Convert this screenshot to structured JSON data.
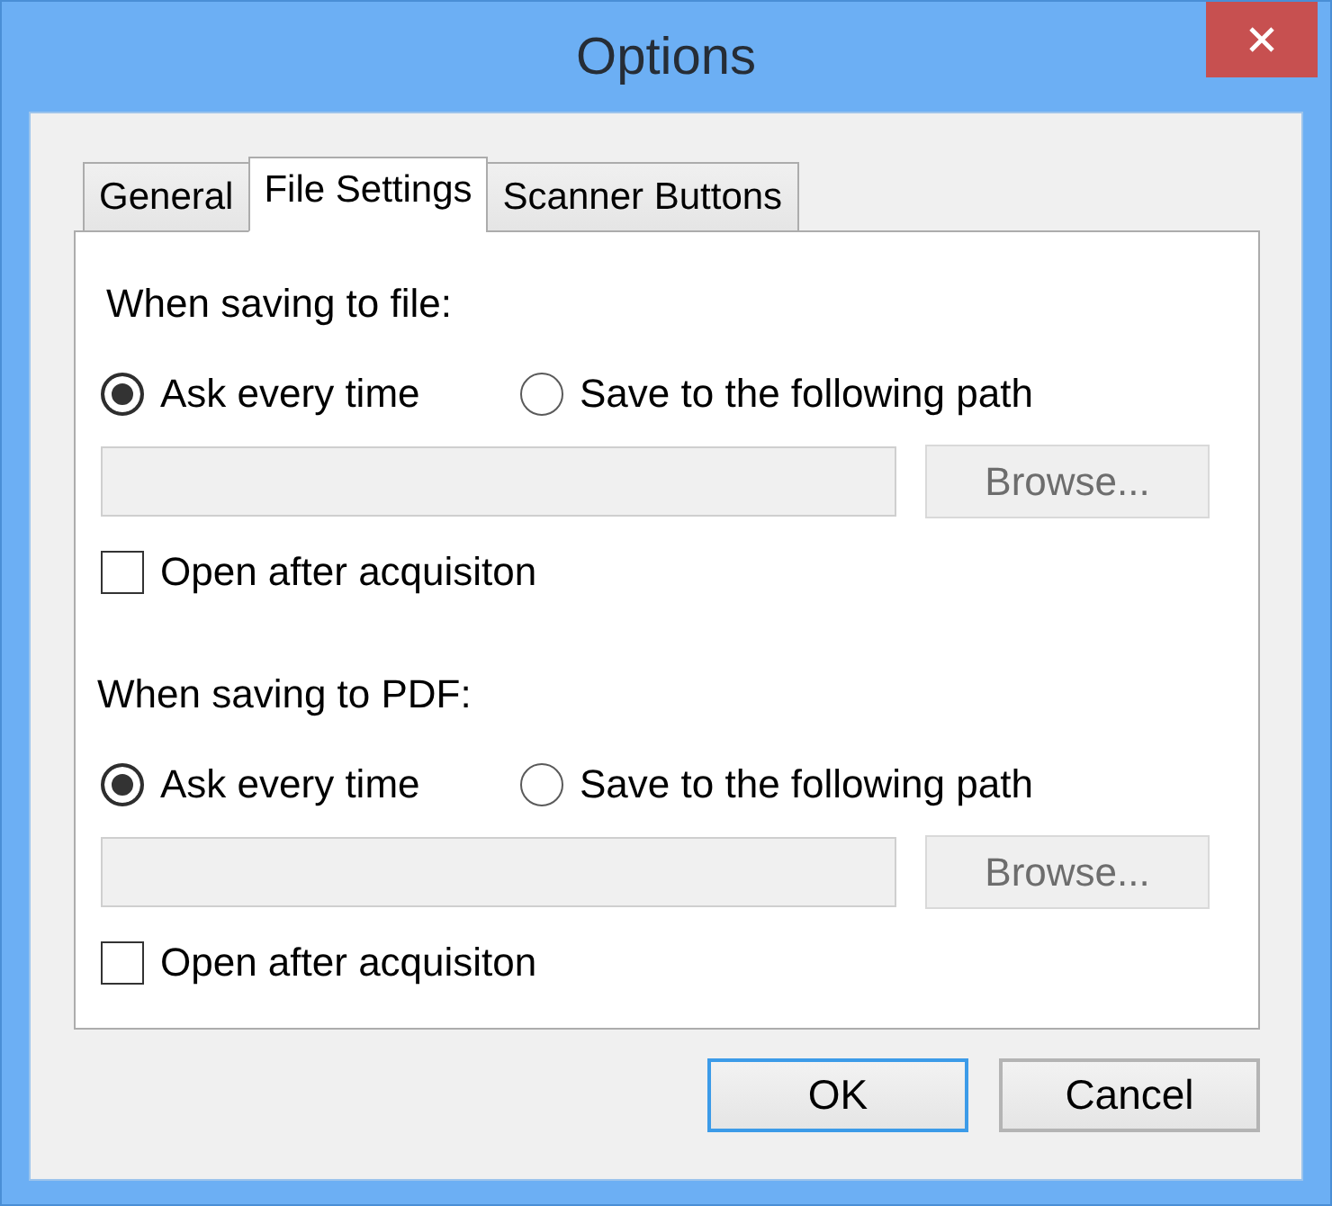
{
  "window": {
    "title": "Options"
  },
  "tabs": [
    {
      "label": "General",
      "selected": false
    },
    {
      "label": "File Settings",
      "selected": true
    },
    {
      "label": "Scanner Buttons",
      "selected": false
    }
  ],
  "sections": [
    {
      "heading": "When saving to file:",
      "options": [
        {
          "label": "Ask every time",
          "selected": true
        },
        {
          "label": "Save to the following path",
          "selected": false
        }
      ],
      "path_field": {
        "disabled": true
      },
      "browse_button": {
        "label": "Browse...",
        "disabled": true
      },
      "checkbox": {
        "label": "Open after acquisiton",
        "checked": false
      }
    },
    {
      "heading": "When saving to PDF:",
      "options": [
        {
          "label": "Ask every time",
          "selected": true
        },
        {
          "label": "Save to the following path",
          "selected": false
        }
      ],
      "path_field": {
        "disabled": true
      },
      "browse_button": {
        "label": "Browse...",
        "disabled": true
      },
      "checkbox": {
        "label": "Open after acquisiton",
        "checked": false
      }
    }
  ],
  "buttons": [
    {
      "label": "OK",
      "default": true
    },
    {
      "label": "Cancel",
      "default": false
    }
  ]
}
